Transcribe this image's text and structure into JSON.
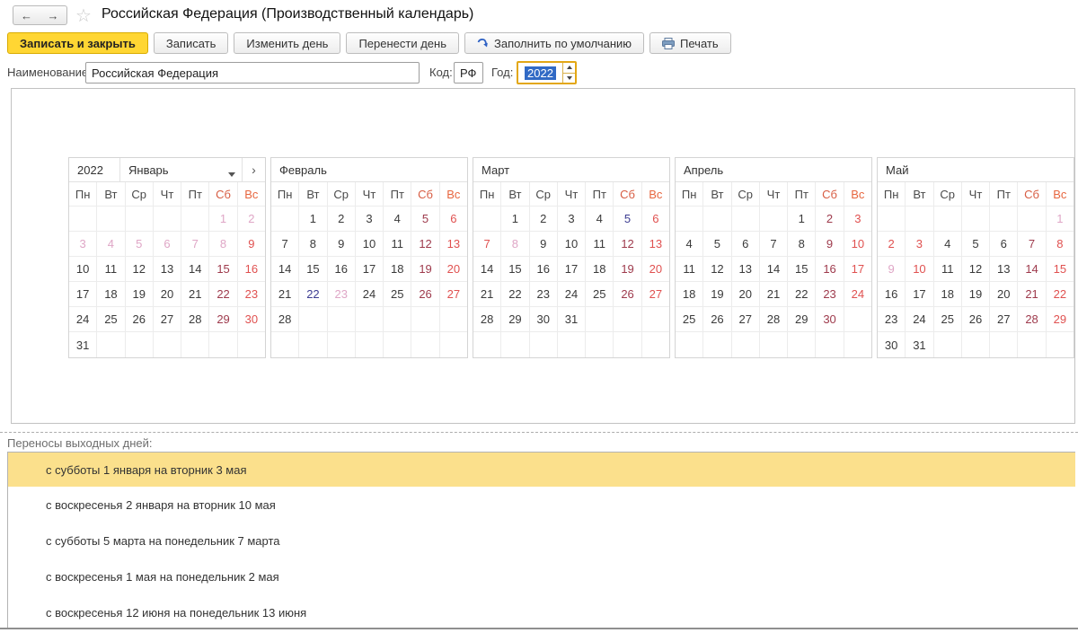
{
  "window": {
    "title": "Российская Федерация (Производственный календарь)"
  },
  "nav": {
    "back": "←",
    "forward": "→",
    "star": "☆"
  },
  "toolbar": {
    "buttons": [
      {
        "label": "Записать и закрыть"
      },
      {
        "label": "Записать"
      },
      {
        "label": "Изменить день"
      },
      {
        "label": "Перенести день"
      },
      {
        "label": "Заполнить по умолчанию",
        "icon": "fill-default-icon"
      },
      {
        "label": "Печать",
        "icon": "printer-icon"
      }
    ]
  },
  "form": {
    "name_label": "Наименование:",
    "name_value": "Российская Федерация",
    "code_label": "Код:",
    "code_value": "РФ",
    "year_label": "Год:",
    "year_value": "2022"
  },
  "calendar": {
    "year": "2022",
    "next_arrow": "›",
    "weekdays": [
      "Пн",
      "Вт",
      "Ср",
      "Чт",
      "Пт",
      "Сб",
      "Вс"
    ],
    "legend": {
      "w": "workday",
      "s": "saturday",
      "u": "sunday",
      "h": "holiday",
      "p": "preholiday-short-day",
      "m": "moved-day-off"
    },
    "months": [
      {
        "name": "Январь",
        "show_year": true,
        "show_nav": true,
        "weeks": [
          [
            null,
            null,
            null,
            null,
            null,
            [
              1,
              "h"
            ],
            [
              2,
              "h"
            ]
          ],
          [
            [
              3,
              "h"
            ],
            [
              4,
              "h"
            ],
            [
              5,
              "h"
            ],
            [
              6,
              "h"
            ],
            [
              7,
              "h"
            ],
            [
              8,
              "h"
            ],
            [
              9,
              "u"
            ]
          ],
          [
            [
              10,
              "w"
            ],
            [
              11,
              "w"
            ],
            [
              12,
              "w"
            ],
            [
              13,
              "w"
            ],
            [
              14,
              "w"
            ],
            [
              15,
              "s"
            ],
            [
              16,
              "u"
            ]
          ],
          [
            [
              17,
              "w"
            ],
            [
              18,
              "w"
            ],
            [
              19,
              "w"
            ],
            [
              20,
              "w"
            ],
            [
              21,
              "w"
            ],
            [
              22,
              "s"
            ],
            [
              23,
              "u"
            ]
          ],
          [
            [
              24,
              "w"
            ],
            [
              25,
              "w"
            ],
            [
              26,
              "w"
            ],
            [
              27,
              "w"
            ],
            [
              28,
              "w"
            ],
            [
              29,
              "s"
            ],
            [
              30,
              "u"
            ]
          ],
          [
            [
              31,
              "w"
            ],
            null,
            null,
            null,
            null,
            null,
            null
          ]
        ]
      },
      {
        "name": "Февраль",
        "show_year": false,
        "show_nav": false,
        "weeks": [
          [
            null,
            [
              1,
              "w"
            ],
            [
              2,
              "w"
            ],
            [
              3,
              "w"
            ],
            [
              4,
              "w"
            ],
            [
              5,
              "s"
            ],
            [
              6,
              "u"
            ]
          ],
          [
            [
              7,
              "w"
            ],
            [
              8,
              "w"
            ],
            [
              9,
              "w"
            ],
            [
              10,
              "w"
            ],
            [
              11,
              "w"
            ],
            [
              12,
              "s"
            ],
            [
              13,
              "u"
            ]
          ],
          [
            [
              14,
              "w"
            ],
            [
              15,
              "w"
            ],
            [
              16,
              "w"
            ],
            [
              17,
              "w"
            ],
            [
              18,
              "w"
            ],
            [
              19,
              "s"
            ],
            [
              20,
              "u"
            ]
          ],
          [
            [
              21,
              "w"
            ],
            [
              22,
              "p"
            ],
            [
              23,
              "h"
            ],
            [
              24,
              "w"
            ],
            [
              25,
              "w"
            ],
            [
              26,
              "s"
            ],
            [
              27,
              "u"
            ]
          ],
          [
            [
              28,
              "w"
            ],
            null,
            null,
            null,
            null,
            null,
            null
          ],
          [
            null,
            null,
            null,
            null,
            null,
            null,
            null
          ]
        ]
      },
      {
        "name": "Март",
        "show_year": false,
        "show_nav": false,
        "weeks": [
          [
            null,
            [
              1,
              "w"
            ],
            [
              2,
              "w"
            ],
            [
              3,
              "w"
            ],
            [
              4,
              "w"
            ],
            [
              5,
              "p"
            ],
            [
              6,
              "u"
            ]
          ],
          [
            [
              7,
              "m"
            ],
            [
              8,
              "h"
            ],
            [
              9,
              "w"
            ],
            [
              10,
              "w"
            ],
            [
              11,
              "w"
            ],
            [
              12,
              "s"
            ],
            [
              13,
              "u"
            ]
          ],
          [
            [
              14,
              "w"
            ],
            [
              15,
              "w"
            ],
            [
              16,
              "w"
            ],
            [
              17,
              "w"
            ],
            [
              18,
              "w"
            ],
            [
              19,
              "s"
            ],
            [
              20,
              "u"
            ]
          ],
          [
            [
              21,
              "w"
            ],
            [
              22,
              "w"
            ],
            [
              23,
              "w"
            ],
            [
              24,
              "w"
            ],
            [
              25,
              "w"
            ],
            [
              26,
              "s"
            ],
            [
              27,
              "u"
            ]
          ],
          [
            [
              28,
              "w"
            ],
            [
              29,
              "w"
            ],
            [
              30,
              "w"
            ],
            [
              31,
              "w"
            ],
            null,
            null,
            null
          ],
          [
            null,
            null,
            null,
            null,
            null,
            null,
            null
          ]
        ]
      },
      {
        "name": "Апрель",
        "show_year": false,
        "show_nav": false,
        "weeks": [
          [
            null,
            null,
            null,
            null,
            [
              1,
              "w"
            ],
            [
              2,
              "s"
            ],
            [
              3,
              "u"
            ]
          ],
          [
            [
              4,
              "w"
            ],
            [
              5,
              "w"
            ],
            [
              6,
              "w"
            ],
            [
              7,
              "w"
            ],
            [
              8,
              "w"
            ],
            [
              9,
              "s"
            ],
            [
              10,
              "u"
            ]
          ],
          [
            [
              11,
              "w"
            ],
            [
              12,
              "w"
            ],
            [
              13,
              "w"
            ],
            [
              14,
              "w"
            ],
            [
              15,
              "w"
            ],
            [
              16,
              "s"
            ],
            [
              17,
              "u"
            ]
          ],
          [
            [
              18,
              "w"
            ],
            [
              19,
              "w"
            ],
            [
              20,
              "w"
            ],
            [
              21,
              "w"
            ],
            [
              22,
              "w"
            ],
            [
              23,
              "s"
            ],
            [
              24,
              "u"
            ]
          ],
          [
            [
              25,
              "w"
            ],
            [
              26,
              "w"
            ],
            [
              27,
              "w"
            ],
            [
              28,
              "w"
            ],
            [
              29,
              "w"
            ],
            [
              30,
              "s"
            ],
            null
          ],
          [
            null,
            null,
            null,
            null,
            null,
            null,
            null
          ]
        ]
      },
      {
        "name": "Май",
        "show_year": false,
        "show_nav": false,
        "weeks": [
          [
            null,
            null,
            null,
            null,
            null,
            null,
            [
              1,
              "h"
            ]
          ],
          [
            [
              2,
              "m"
            ],
            [
              3,
              "m"
            ],
            [
              4,
              "w"
            ],
            [
              5,
              "w"
            ],
            [
              6,
              "w"
            ],
            [
              7,
              "s"
            ],
            [
              8,
              "u"
            ]
          ],
          [
            [
              9,
              "h"
            ],
            [
              10,
              "m"
            ],
            [
              11,
              "w"
            ],
            [
              12,
              "w"
            ],
            [
              13,
              "w"
            ],
            [
              14,
              "s"
            ],
            [
              15,
              "u"
            ]
          ],
          [
            [
              16,
              "w"
            ],
            [
              17,
              "w"
            ],
            [
              18,
              "w"
            ],
            [
              19,
              "w"
            ],
            [
              20,
              "w"
            ],
            [
              21,
              "s"
            ],
            [
              22,
              "u"
            ]
          ],
          [
            [
              23,
              "w"
            ],
            [
              24,
              "w"
            ],
            [
              25,
              "w"
            ],
            [
              26,
              "w"
            ],
            [
              27,
              "w"
            ],
            [
              28,
              "s"
            ],
            [
              29,
              "u"
            ]
          ],
          [
            [
              30,
              "w"
            ],
            [
              31,
              "w"
            ],
            null,
            null,
            null,
            null,
            null
          ]
        ]
      }
    ]
  },
  "transfers": {
    "label": "Переносы выходных дней:",
    "selected_index": 0,
    "items": [
      "с субботы 1 января на вторник 3 мая",
      "с воскресенья 2 января на вторник 10 мая",
      "с субботы 5 марта на понедельник 7 марта",
      "с воскресенья 1 мая на понедельник 2 мая",
      "с воскресенья 12 июня на понедельник 13 июня"
    ]
  },
  "colors": {
    "accent_yellow": "#ffd633",
    "selected_row_yellow": "#fbe08c",
    "year_focus_border": "#e3a714",
    "selection_blue": "#316ac5",
    "weekday_header": "#4a4a4a",
    "sat_header": "#d75c42",
    "sun_header": "#e7663f",
    "day": {
      "w": "#3a3a3a",
      "s": "#9e3a4c",
      "u": "#e05150",
      "h": "#dfa6c6",
      "p": "#3d3d92",
      "m": "#e05150"
    }
  }
}
